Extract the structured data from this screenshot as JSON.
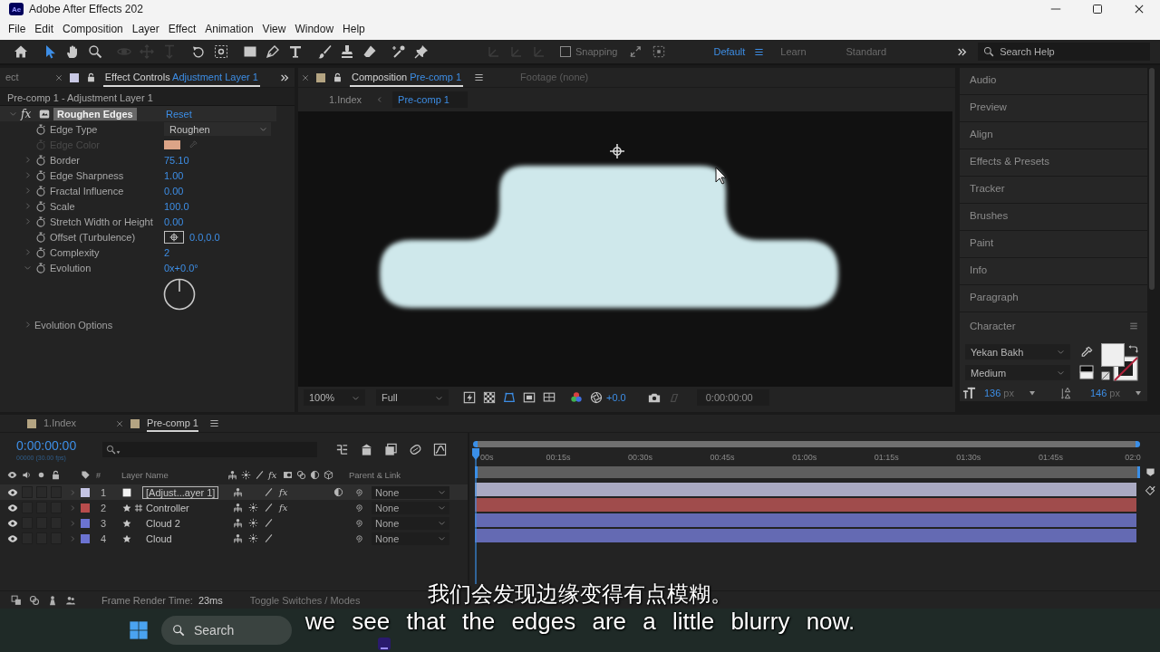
{
  "window": {
    "logo": "Ae",
    "title": "Adobe After Effects 202"
  },
  "menu": [
    "File",
    "Edit",
    "Composition",
    "Layer",
    "Effect",
    "Animation",
    "View",
    "Window",
    "Help"
  ],
  "toolbar": {
    "tools": [
      {
        "kind": "home",
        "selected": false,
        "disabled": false
      },
      {
        "kind": "selection",
        "selected": true,
        "disabled": false
      },
      {
        "kind": "hand",
        "selected": false,
        "disabled": false
      },
      {
        "kind": "zoom",
        "selected": false,
        "disabled": false
      },
      {
        "kind": "orbit",
        "selected": false,
        "disabled": true
      },
      {
        "kind": "pan",
        "selected": false,
        "disabled": true
      },
      {
        "kind": "dolly",
        "selected": false,
        "disabled": true
      },
      {
        "kind": "rotate",
        "selected": false,
        "disabled": false
      },
      {
        "kind": "pan_behind",
        "selected": false,
        "disabled": false
      },
      {
        "kind": "rectangle",
        "selected": false,
        "disabled": false
      },
      {
        "kind": "pen",
        "selected": false,
        "disabled": false
      },
      {
        "kind": "type",
        "selected": false,
        "disabled": false
      },
      {
        "kind": "brush",
        "selected": false,
        "disabled": false
      },
      {
        "kind": "stamp",
        "selected": false,
        "disabled": false
      },
      {
        "kind": "eraser",
        "selected": false,
        "disabled": false
      },
      {
        "kind": "roto",
        "selected": false,
        "disabled": false
      },
      {
        "kind": "pin",
        "selected": false,
        "disabled": false
      },
      {
        "kind": "axis",
        "selected": false,
        "disabled": true
      },
      {
        "kind": "axis",
        "selected": false,
        "disabled": true
      },
      {
        "kind": "axis",
        "selected": false,
        "disabled": true
      }
    ],
    "snapping": {
      "label": "Snapping",
      "checked": false
    },
    "workspaces": [
      {
        "label": "Default",
        "selected": true
      },
      {
        "label": "Learn",
        "selected": false
      },
      {
        "label": "Standard",
        "selected": false
      }
    ],
    "search": {
      "placeholder": "Search Help"
    }
  },
  "effect_controls": {
    "tabs": [
      {
        "label": "ect",
        "selected": false
      },
      {
        "label": "Effect Controls",
        "target": "Adjustment Layer 1",
        "selected": true
      }
    ],
    "layer_path": "Pre-comp 1 - Adjustment Layer 1",
    "effect": {
      "badge": "fx",
      "name": "Roughen Edges",
      "reset": "Reset",
      "expanded": true
    },
    "properties": [
      {
        "kind": "dropdown",
        "name": "Edge Type",
        "value": "Roughen",
        "disabled": false
      },
      {
        "kind": "color",
        "name": "Edge Color",
        "color": "#dca487",
        "disabled": true
      },
      {
        "kind": "number",
        "name": "Border",
        "value": "75.10",
        "disabled": false,
        "expanded": false
      },
      {
        "kind": "number",
        "name": "Edge Sharpness",
        "value": "1.00",
        "disabled": false,
        "expanded": false
      },
      {
        "kind": "number",
        "name": "Fractal Influence",
        "value": "0.00",
        "disabled": false,
        "expanded": false
      },
      {
        "kind": "number",
        "name": "Scale",
        "value": "100.0",
        "disabled": false,
        "expanded": false
      },
      {
        "kind": "number",
        "name": "Stretch Width or Height",
        "value": "0.00",
        "disabled": false,
        "expanded": false
      },
      {
        "kind": "point",
        "name": "Offset (Turbulence)",
        "value": "0.0,0.0",
        "disabled": false
      },
      {
        "kind": "number",
        "name": "Complexity",
        "value": "2",
        "disabled": false,
        "expanded": false
      },
      {
        "kind": "angle",
        "name": "Evolution",
        "value": "0x+0.0°",
        "disabled": false,
        "expanded": true
      }
    ],
    "groups": [
      {
        "name": "Evolution Options",
        "expanded": false
      }
    ]
  },
  "composition": {
    "tabs": [
      {
        "label": "Composition",
        "target": "Pre-comp 1",
        "selected": true
      },
      {
        "label": "Footage",
        "target": "(none)",
        "selected": false
      }
    ],
    "breadcrumbs": [
      {
        "label": "1.Index",
        "selected": false
      },
      {
        "label": "Pre-comp 1",
        "selected": true
      }
    ],
    "zoom": "100%",
    "resolution": "Full",
    "exposure": "+0.0",
    "timecode": "0:00:00:00"
  },
  "side_panels": [
    "Audio",
    "Preview",
    "Align",
    "Effects & Presets",
    "Tracker",
    "Brushes",
    "Paint",
    "Info",
    "Paragraph"
  ],
  "character": {
    "title": "Character",
    "font": "Yekan Bakh",
    "style": "Medium",
    "size": {
      "value": "136",
      "unit": "px"
    },
    "leading": {
      "value": "146",
      "unit": "px"
    }
  },
  "timeline": {
    "tabs": [
      {
        "label": "1.Index",
        "selected": false
      },
      {
        "label": "Pre-comp 1",
        "selected": true
      }
    ],
    "timecode": "0:00:00:00",
    "frame_info": "00000 (30.00 fps)",
    "columns": {
      "number": "#",
      "name": "Layer Name",
      "fx": "fx",
      "parent": "Parent & Link"
    },
    "ruler": [
      "00s",
      "00:15s",
      "00:30s",
      "00:45s",
      "01:00s",
      "01:15s",
      "01:30s",
      "01:45s",
      "02:0"
    ],
    "layers": [
      {
        "number": "1",
        "kind": "adjustment",
        "name": "[Adjust...ayer 1]",
        "color": "#c4c4e4",
        "selected": true,
        "expanded": false,
        "fx": "fx",
        "parent": "None"
      },
      {
        "number": "2",
        "kind": "shape_grid",
        "name": "Controller",
        "color": "#b84c4c",
        "selected": false,
        "expanded": false,
        "fx": "fx",
        "parent": "None"
      },
      {
        "number": "3",
        "kind": "shape",
        "name": "Cloud 2",
        "color": "#6b73d1",
        "selected": false,
        "expanded": false,
        "parent": "None"
      },
      {
        "number": "4",
        "kind": "shape",
        "name": "Cloud",
        "color": "#6b73d1",
        "selected": false,
        "expanded": false,
        "parent": "None"
      }
    ],
    "render_label": "Frame Render Time:",
    "render_time": "23ms",
    "toggle_label": "Toggle Switches / Modes"
  },
  "taskbar": {
    "search": {
      "placeholder": "Search"
    }
  },
  "subtitles": [
    "我们会发现边缘变得有点模糊。",
    "we see that the edges are a little blurry now."
  ]
}
